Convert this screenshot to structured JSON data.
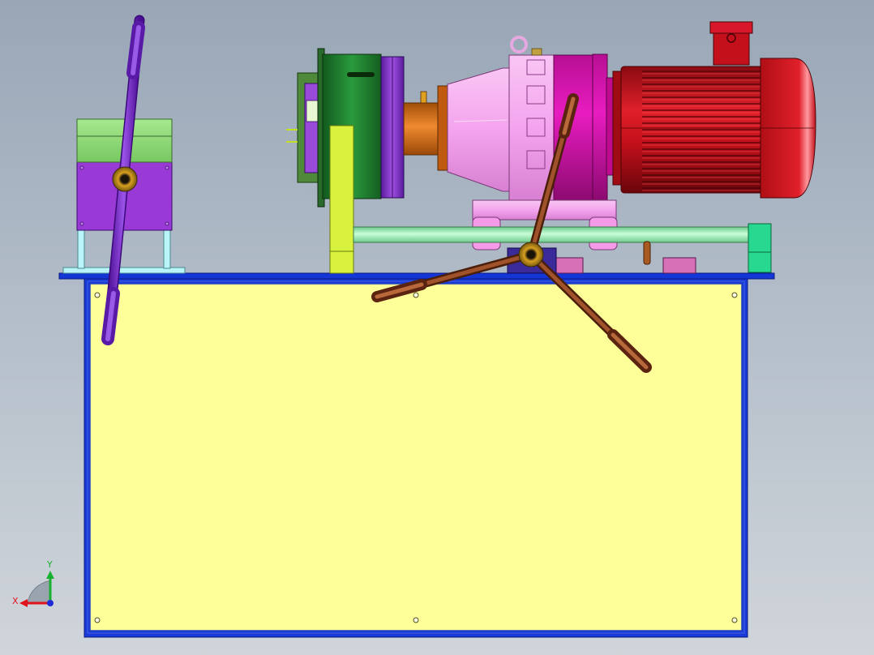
{
  "viewport": {
    "background_top": "#98a6b6",
    "background_bottom": "#d0d5da"
  },
  "axis_triad": {
    "x_label": "X",
    "y_label": "Y",
    "x_color": "#e0141c",
    "y_color": "#18b030",
    "z_color": "#1f2ad8"
  },
  "colors": {
    "tank_panel": "#ffff99",
    "tank_frame": "#1536d6",
    "motor_red": "#c3101a",
    "gearbox_pink": "#f4a4ee",
    "gearbox_magenta": "#e01ab8",
    "handle_purple": "#7222c8",
    "handwheel_brown": "#8a3c1e",
    "flange_green": "#1f7a2e",
    "shaft_mint": "#9ff0b8",
    "coupling_orange": "#d26a12",
    "support_yellow_green": "#d8f23e",
    "pump_block_purple": "#9a3ad6",
    "pump_top_green": "#8fde7a"
  }
}
